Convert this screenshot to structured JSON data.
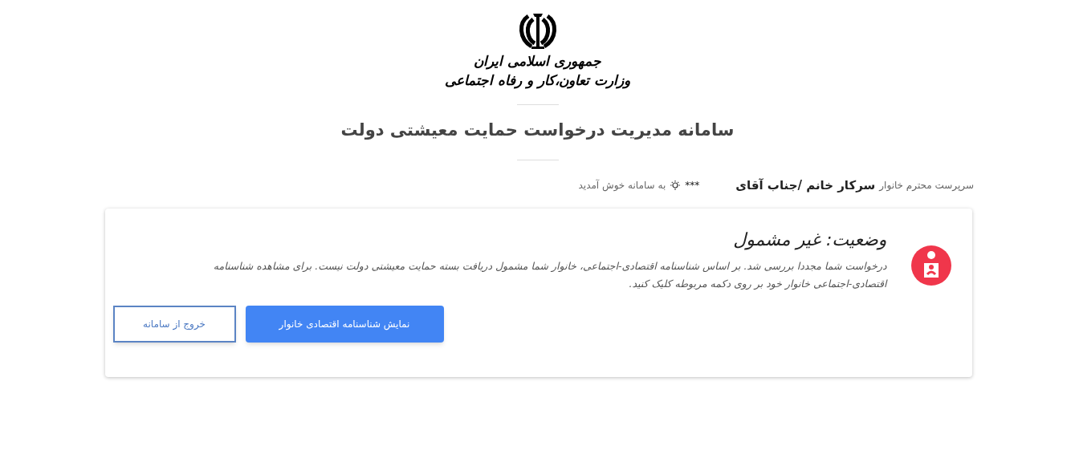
{
  "header": {
    "emblem_lines": [
      "جمهوری اسلامی ایران",
      "وزارت تعاون،کار و رفاه اجتماعی"
    ],
    "title": "سامانه مدیریت درخواست حمایت معیشتی دولت"
  },
  "greeting": {
    "role": "سرپرست محترم خانوار",
    "salutation": "سرکار خانم /جناب آقای",
    "name": "***",
    "welcome": "به سامانه خوش آمدید"
  },
  "status_card": {
    "title": "وضعیت: غیر مشمول",
    "message": "درخواست شما مجددا بررسی شد. بر اساس شناسنامه اقتصادی-اجتماعی، خانوار شما مشمول دریافت بسته حمایت معیشتی دولت نیست. برای مشاهده شناسنامه اقتصادی-اجتماعی خانوار خود بر روی دکمه مربوطه کلیک کنید.",
    "buttons": [
      {
        "label": "نمایش شناسنامه اقتصادی خانوار",
        "kind": "primary"
      },
      {
        "label": "خروج از سامانه",
        "kind": "outline"
      }
    ]
  }
}
